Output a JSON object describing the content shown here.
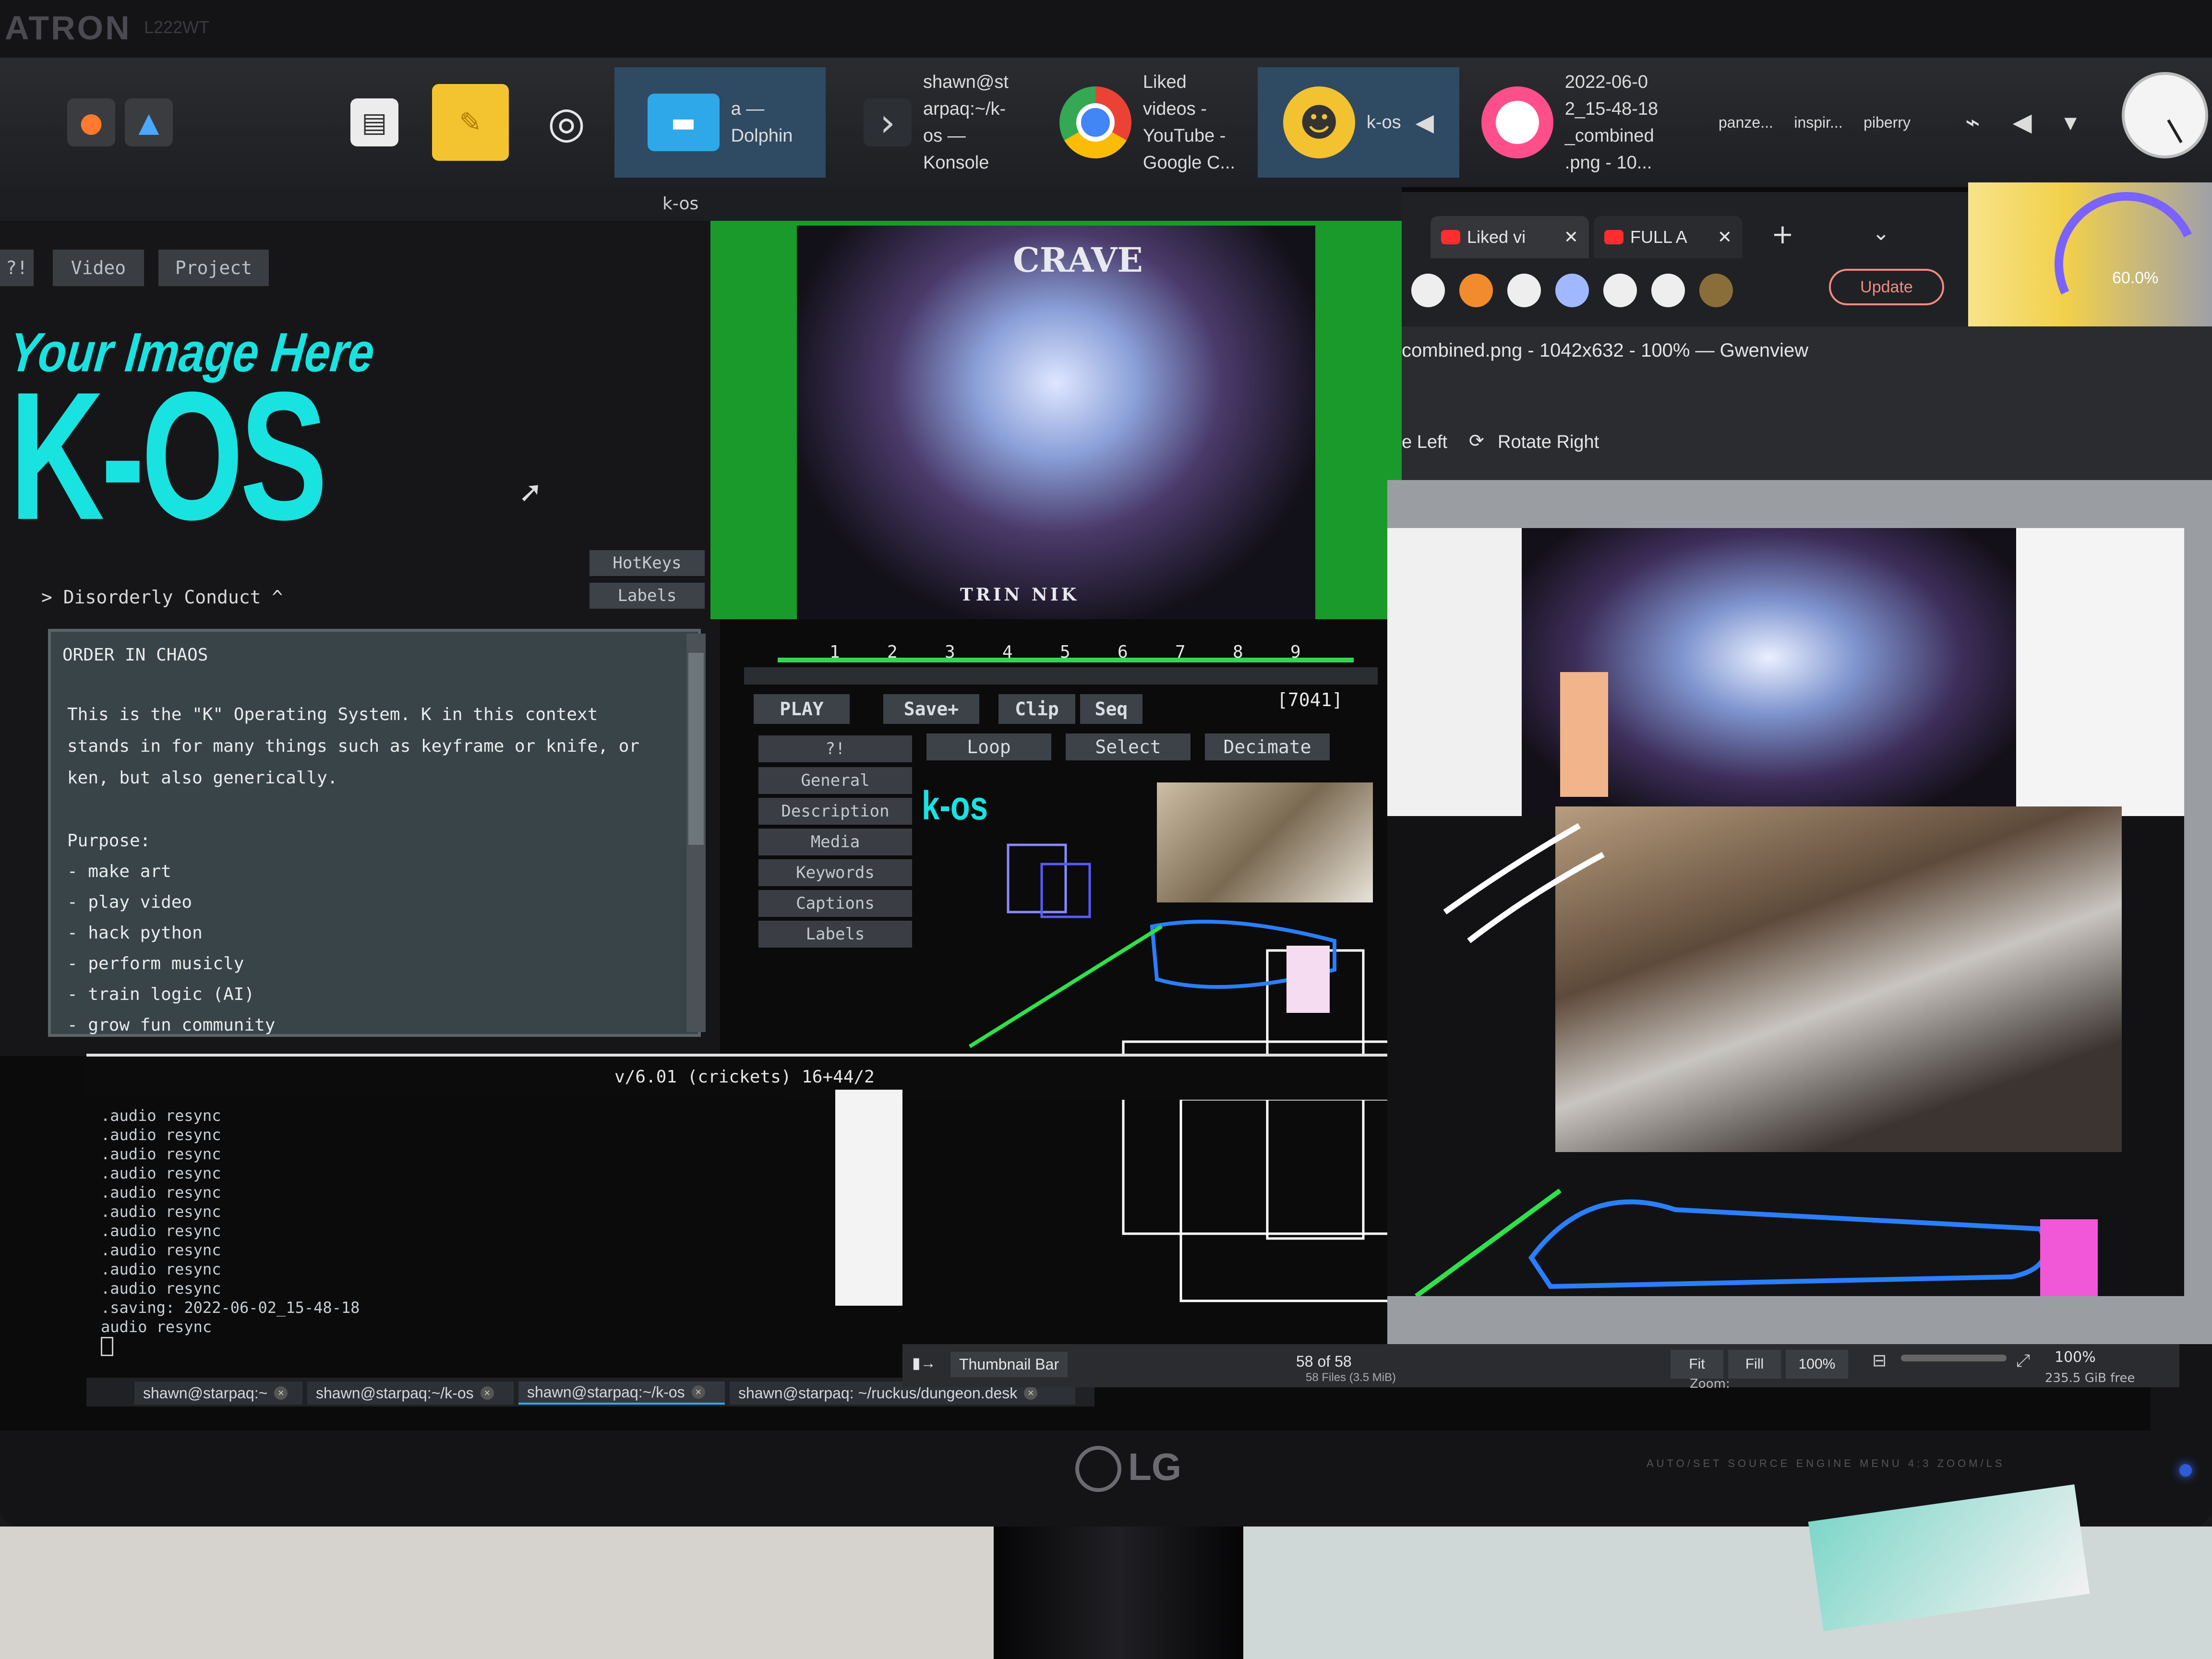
{
  "monitor": {
    "brand": "ATRON",
    "model": "L222WT",
    "logo": "LG",
    "buttons": "AUTO/SET  SOURCE  ENGINE  MENU  4:3 ZOOM/LS"
  },
  "taskbar": {
    "items": [
      {
        "icon": "dolphin-folder-icon",
        "label": "a —\nDolphin"
      },
      {
        "icon": "konsole-terminal-icon",
        "label": "shawn@st\narpaq:~/k-\nos —\nKonsole"
      },
      {
        "icon": "chrome-icon",
        "label": "Liked\nvideos -\nYouTube -\nGoogle C..."
      },
      {
        "icon": "kos-mascot-icon",
        "label": "k-os"
      },
      {
        "icon": "gwenview-icon",
        "label": "2022-06-0\n2_15-48-18\n_combined\n.png - 10..."
      }
    ],
    "tray_labels": [
      "panze...",
      "inspir...",
      "piberry"
    ]
  },
  "kos": {
    "window_title": "k-os",
    "tabs": [
      "?!",
      "Video",
      "Project"
    ],
    "logo_tagline": "Your Image Here",
    "logo_big": "K-OS",
    "breadcrumb": "> Disorderly Conduct ^",
    "side_buttons": [
      "HotKeys",
      "Labels"
    ],
    "info": {
      "title": "ORDER IN CHAOS",
      "body": "This is the \"K\" Operating System. K in this context\nstands in for many things such as keyframe or knife, or\nken, but also generically.",
      "purpose_heading": "Purpose:",
      "purpose_items": [
        "- make art",
        "- play video",
        "- hack python",
        "- perform musicly",
        "- train logic (AI)",
        "- grow fun community"
      ]
    },
    "preview": {
      "art_title": "CRAVE",
      "art_sub": "TRIN NIK"
    },
    "timeline_numbers": [
      "1",
      "2",
      "3",
      "4",
      "5",
      "6",
      "7",
      "8",
      "9"
    ],
    "controls_row1": [
      "PLAY",
      "Save+",
      "Clip",
      "Seq"
    ],
    "frame_count": "[7041]",
    "controls_row2": [
      "Loop",
      "Select",
      "Decimate"
    ],
    "menu": [
      "?!",
      "General",
      "Description",
      "Media",
      "Keywords",
      "Captions",
      "Labels"
    ],
    "mini_logo": "k-os",
    "version": "v/6.01 (crickets) 16+44/2"
  },
  "konsole": {
    "lines": [
      ".audio resync",
      ".audio resync",
      ".audio resync",
      ".audio resync",
      ".audio resync",
      ".audio resync",
      ".audio resync",
      ".audio resync",
      ".audio resync",
      ".audio resync",
      ".saving: 2022-06-02_15-48-18",
      "audio resync"
    ],
    "tabs": [
      "shawn@starpaq:~",
      "shawn@starpaq:~/k-os",
      "shawn@starpaq:~/k-os",
      "shawn@starpaq: ~/ruckus/dungeon.desk"
    ]
  },
  "chrome": {
    "tabs": [
      "Liked vi",
      "FULL A"
    ],
    "update_label": "Update"
  },
  "widget": {
    "gauge_value": "60.0%"
  },
  "gwenview": {
    "title": "combined.png - 1042x632 - 100% — Gwenview",
    "toolbar": {
      "rotate_left": "e Left",
      "rotate_right": "Rotate Right"
    },
    "thumbnail_bar": "Thumbnail Bar",
    "position": "58 of 58",
    "file_info": "58 Files (3.5 MiB)",
    "zoom_buttons": [
      "Fit",
      "Fill",
      "100%"
    ],
    "zoom_value": "100%",
    "zoom_label": "Zoom:",
    "free_space": "235.5 GiB free"
  }
}
